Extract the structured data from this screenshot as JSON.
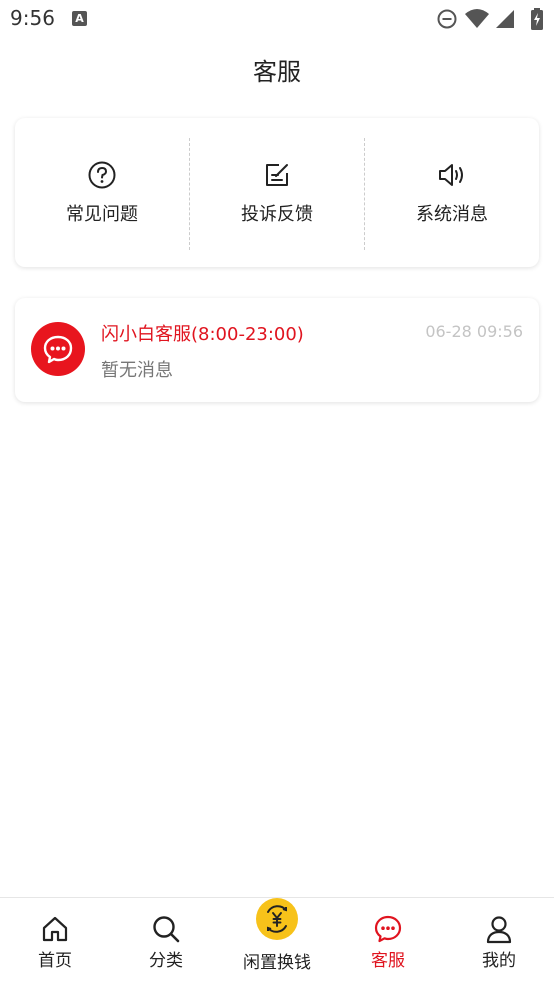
{
  "status_bar": {
    "time": "9:56",
    "notification_icon_letter": "A",
    "icons": [
      "do-not-disturb-icon",
      "wifi-icon",
      "signal-icon",
      "battery-icon"
    ]
  },
  "header": {
    "title": "客服"
  },
  "quick_menu": {
    "items": [
      {
        "label": "常见问题",
        "icon": "question-circle-icon"
      },
      {
        "label": "投诉反馈",
        "icon": "edit-icon"
      },
      {
        "label": "系统消息",
        "icon": "speaker-icon"
      }
    ]
  },
  "chat_list": {
    "items": [
      {
        "name": "闪小白客服(8:00-23:00)",
        "time": "06-28 09:56",
        "preview": "暂无消息",
        "avatar_icon": "chat-bubble-icon"
      }
    ]
  },
  "bottom_nav": {
    "items": [
      {
        "label": "首页",
        "icon": "home-icon",
        "active": false
      },
      {
        "label": "分类",
        "icon": "search-icon",
        "active": false
      },
      {
        "label": "闲置换钱",
        "icon": "yen-exchange-icon",
        "active": false
      },
      {
        "label": "客服",
        "icon": "chat-bubble-icon",
        "active": true
      },
      {
        "label": "我的",
        "icon": "user-icon",
        "active": false
      }
    ]
  },
  "colors": {
    "accent": "#e0141f",
    "exchange_yellow": "#f7c21a",
    "muted_text": "#777777",
    "timestamp": "#c4c4c4"
  }
}
